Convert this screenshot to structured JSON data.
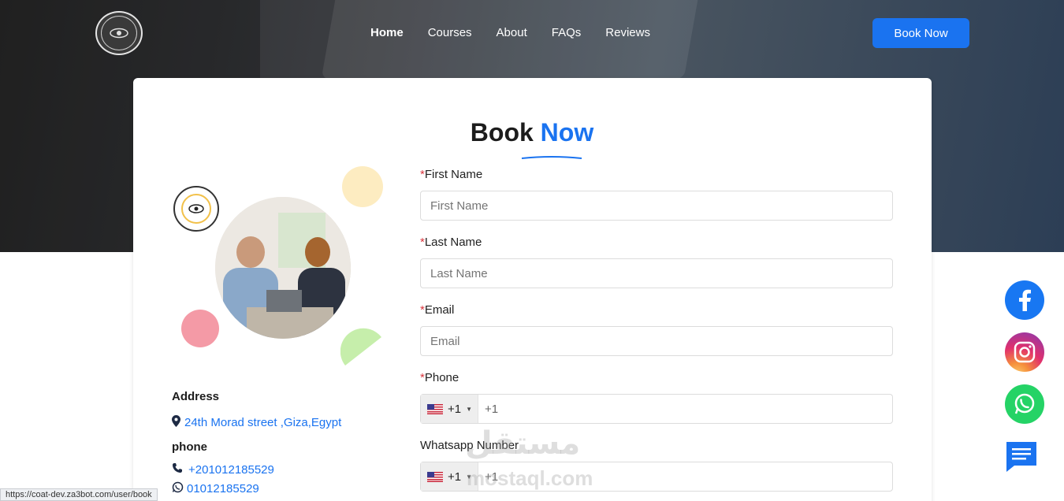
{
  "nav": {
    "logo_alt": "CAST",
    "items": [
      {
        "label": "Home",
        "active": true
      },
      {
        "label": "Courses"
      },
      {
        "label": "About"
      },
      {
        "label": "FAQs"
      },
      {
        "label": "Reviews"
      }
    ],
    "book_button": "Book Now"
  },
  "page": {
    "title_main": "Book",
    "title_accent": "Now"
  },
  "contact": {
    "address_heading": "Address",
    "address_value": "24th Morad street ,Giza,Egypt",
    "phone_heading": "phone",
    "phone_1": "+201012185529",
    "phone_2": "01012185529"
  },
  "form": {
    "first_name": {
      "label": "First Name",
      "placeholder": "First Name",
      "required": "*"
    },
    "last_name": {
      "label": "Last Name",
      "placeholder": "Last Name",
      "required": "*"
    },
    "email": {
      "label": "Email",
      "placeholder": "Email",
      "required": "*"
    },
    "phone": {
      "label": "Phone",
      "country_code": "+1",
      "placeholder": "+1",
      "required": "*"
    },
    "whatsapp": {
      "label": "Whatsapp Number",
      "country_code": "+1",
      "placeholder": "+1"
    }
  },
  "social": {
    "icons": [
      "facebook-icon",
      "instagram-icon",
      "whatsapp-icon",
      "chat-icon"
    ]
  },
  "watermark": {
    "arabic": "مستقل",
    "latin": "mostaql.com"
  },
  "status_bar": {
    "url": "https://coat-dev.za3bot.com/user/book"
  },
  "colors": {
    "accent": "#1a73f0",
    "required": "#d9363e"
  }
}
